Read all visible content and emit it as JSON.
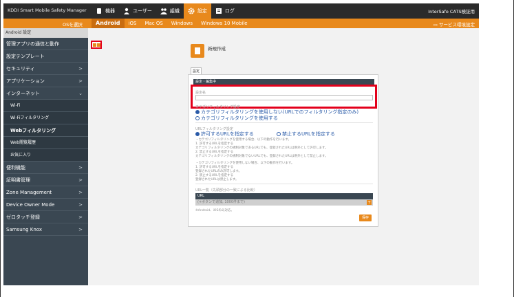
{
  "app": {
    "title": "KDDI Smart Mobile Safety Manager",
    "org_name": "InterSafe CATS検証用"
  },
  "nav": [
    {
      "label": "機器",
      "icon": "device-icon",
      "active": false
    },
    {
      "label": "ユーザー",
      "icon": "user-icon",
      "active": false
    },
    {
      "label": "組織",
      "icon": "organization-icon",
      "active": false
    },
    {
      "label": "設定",
      "icon": "gear-icon",
      "active": true
    },
    {
      "label": "ログ",
      "icon": "log-icon",
      "active": false
    }
  ],
  "osbar": {
    "select_label": "OSを選択",
    "tabs": [
      "Android",
      "iOS",
      "Mac OS",
      "Windows",
      "Windows 10 Mobile"
    ],
    "active_tab": "Android",
    "service_settings": "サービス環境設定"
  },
  "sidebar": {
    "header": "Android 設定",
    "items": [
      {
        "label": "管理アプリの通信と動作",
        "chevron": ""
      },
      {
        "label": "設定テンプレート",
        "chevron": ""
      },
      {
        "label": "セキュリティ",
        "chevron": ">"
      },
      {
        "label": "アプリケーション",
        "chevron": ">"
      },
      {
        "label": "インターネット",
        "chevron": "⌄"
      },
      {
        "label": "Wi-Fi",
        "sub": true
      },
      {
        "label": "Wi-Fiフィルタリング",
        "sub": true
      },
      {
        "label": "Webフィルタリング",
        "sub": true,
        "active": true
      },
      {
        "label": "Web閲覧履歴",
        "sub": true
      },
      {
        "label": "お気に入り",
        "sub": true
      },
      {
        "label": "便利機能",
        "chevron": ">"
      },
      {
        "label": "証明書管理",
        "chevron": ">"
      },
      {
        "label": "Zone Management",
        "chevron": ">"
      },
      {
        "label": "Device Owner Mode",
        "chevron": ">"
      },
      {
        "label": "ゼロタッチ登録",
        "chevron": ">"
      },
      {
        "label": "Samsung Knox",
        "chevron": ">"
      }
    ]
  },
  "main": {
    "new_title": "新規作成",
    "tab_label": "設定",
    "panel_header": "設定・編集中",
    "name_label": "設定名",
    "name_value": "",
    "category_label": "カテゴリフィルタリング設定",
    "radio_no_category": "カテゴリフィルタリングを使用しない(URLでのフィルタリング指定のみ)",
    "radio_use_category": "カテゴリフィルタリングを使用する",
    "url_label": "URLフィルタリング設定",
    "radio_allow": "許可するURLを指定する",
    "radio_block": "禁止するURLを指定する",
    "notes": [
      "・カテゴリフィルタリングを使用する場合、以下の動作を行います。",
      "  1. 許可するURLを指定する",
      "     カテゴリフィルタリングの規制対象であるURLでも、登録されたURLは例外として許可します。",
      "  2. 禁止するURLを指定する",
      "     カテゴリフィルタリングの規制対象でないURLでも、登録されたURLは例外として禁止します。",
      "・カテゴリフィルタリングを使用しない場合、以下の動作を行います。",
      "  1. 許可するURLを指定する",
      "     登録されたURLのみ許可します。",
      "  2. 禁止するURLを指定する",
      "     登録されたURLは禁止します。"
    ],
    "url_list_label": "URL一覧（先頭部分の一致による比較）",
    "url_col": "URL",
    "url_placeholder": "(+ボタンで追加, 1000件まで)",
    "footnote": "※Android、iOSのみ対応。",
    "save_label": "保存"
  },
  "colors": {
    "accent": "#e8891c",
    "sidebar": "#3a4752",
    "highlight": "#e3001b",
    "topbar": "#2b2b2b"
  }
}
